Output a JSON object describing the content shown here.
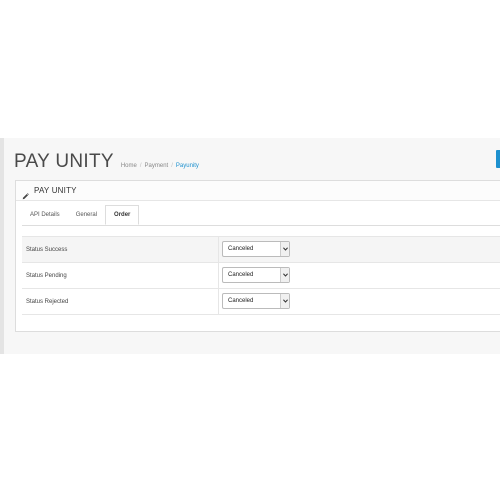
{
  "header": {
    "title": "PAY UNITY",
    "breadcrumb": [
      "Home",
      "Payment",
      "Payunity"
    ],
    "separator": "/"
  },
  "panel": {
    "title": "PAY UNITY",
    "icon": "pencil-icon"
  },
  "tabs": [
    {
      "label": "API Details",
      "active": false
    },
    {
      "label": "General",
      "active": false
    },
    {
      "label": "Order",
      "active": true
    }
  ],
  "form": {
    "rows": [
      {
        "label": "Status Success",
        "value": "Canceled"
      },
      {
        "label": "Status Pending",
        "value": "Canceled"
      },
      {
        "label": "Status Rejected",
        "value": "Canceled"
      }
    ]
  },
  "colors": {
    "accent": "#1e91cf",
    "background": "#f7f7f7"
  }
}
